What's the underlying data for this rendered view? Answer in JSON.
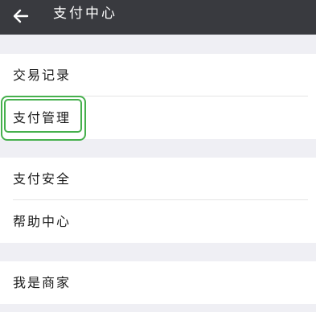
{
  "header": {
    "title": "支付中心"
  },
  "groups": [
    {
      "items": [
        {
          "label": "交易记录"
        },
        {
          "label": "支付管理"
        }
      ]
    },
    {
      "items": [
        {
          "label": "支付安全"
        },
        {
          "label": "帮助中心"
        }
      ]
    },
    {
      "items": [
        {
          "label": "我是商家"
        }
      ]
    }
  ],
  "colors": {
    "header_bg": "#393a3f",
    "page_bg": "#efeff4",
    "highlight_border": "#46b04d"
  },
  "icons": {
    "back": "arrow-left-icon"
  }
}
